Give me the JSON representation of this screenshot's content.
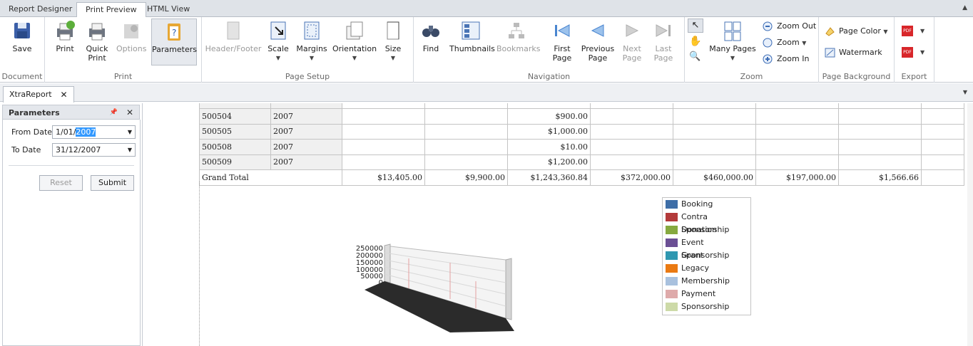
{
  "tabs": [
    "Report Designer",
    "Print Preview",
    "HTML View"
  ],
  "ribbon": {
    "document": {
      "label": "Document",
      "save": "Save"
    },
    "print": {
      "label": "Print",
      "print": "Print",
      "quick_print_1": "Quick",
      "quick_print_2": "Print",
      "options": "Options",
      "parameters": "Parameters"
    },
    "page_setup": {
      "label": "Page Setup",
      "header_footer": "Header/Footer",
      "scale": "Scale",
      "margins": "Margins",
      "orientation": "Orientation",
      "size": "Size"
    },
    "navigation": {
      "label": "Navigation",
      "find": "Find",
      "thumbnails": "Thumbnails",
      "bookmarks": "Bookmarks",
      "first_1": "First",
      "first_2": "Page",
      "prev_1": "Previous",
      "prev_2": "Page",
      "next_1": "Next",
      "next_2": "Page",
      "last_1": "Last",
      "last_2": "Page"
    },
    "zoom": {
      "label": "Zoom",
      "many_pages": "Many Pages",
      "zoom_out": "Zoom Out",
      "zoom": "Zoom",
      "zoom_in": "Zoom In"
    },
    "page_background": {
      "label": "Page Background",
      "page_color": "Page Color",
      "watermark": "Watermark"
    },
    "export": {
      "label": "Export"
    }
  },
  "document_tab": "XtraReport",
  "parameters": {
    "title": "Parameters",
    "from_label": "From Date",
    "from_prefix": "1/01/",
    "from_sel": "2007",
    "to_label": "To Date",
    "to_value": "31/12/2007",
    "reset": "Reset",
    "submit": "Submit"
  },
  "table": {
    "rows": [
      {
        "id": "500504",
        "year": "2007",
        "c": "$900.00"
      },
      {
        "id": "500505",
        "year": "2007",
        "c": "$1,000.00"
      },
      {
        "id": "500508",
        "year": "2007",
        "c": "$10.00"
      },
      {
        "id": "500509",
        "year": "2007",
        "c": "$1,200.00"
      }
    ],
    "grand_total": {
      "label": "Grand Total",
      "values": [
        "$13,405.00",
        "$9,900.00",
        "$1,243,360.84",
        "$372,000.00",
        "$460,000.00",
        "$197,000.00",
        "$1,566.66"
      ]
    }
  },
  "legend": [
    {
      "name": "Booking",
      "color": "#3e6ea7"
    },
    {
      "name": "Contra Sponsorship",
      "color": "#b33a3a"
    },
    {
      "name": "Donation",
      "color": "#86a93f"
    },
    {
      "name": "Event Sponsorship",
      "color": "#6b4f94"
    },
    {
      "name": "Grant",
      "color": "#2f97b0"
    },
    {
      "name": "Legacy",
      "color": "#ea7a12"
    },
    {
      "name": "Membership",
      "color": "#a9c1de"
    },
    {
      "name": "Payment",
      "color": "#deaaaa"
    },
    {
      "name": "Sponsorship",
      "color": "#cddaa8"
    }
  ],
  "chart_data": {
    "type": "bar",
    "y_ticks": [
      "250000",
      "200000",
      "150000",
      "100000",
      "50000",
      "0"
    ],
    "ylim": [
      0,
      250000
    ]
  }
}
